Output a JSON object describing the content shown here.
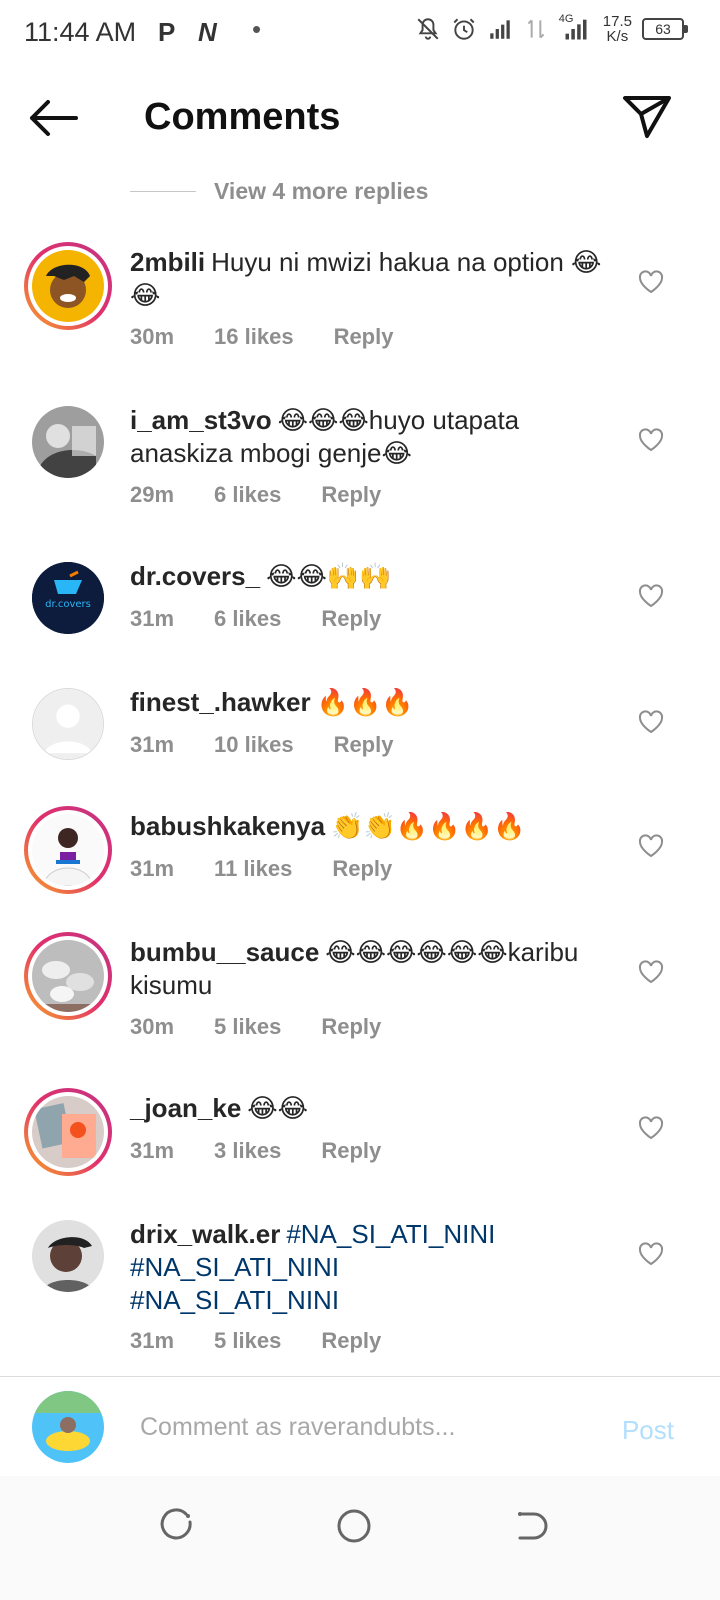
{
  "status_bar": {
    "time": "11:44 AM",
    "app_icons": [
      "P",
      "N"
    ],
    "net_speed_value": "17.5",
    "net_speed_unit": "K/s",
    "network_label": "4G",
    "battery": "63"
  },
  "header": {
    "title": "Comments"
  },
  "view_more_replies": "View 4 more replies",
  "comments": [
    {
      "username": "2mbili",
      "text": "Huyu ni mwizi hakua na option 😂😂",
      "time": "30m",
      "likes": "16 likes",
      "reply": "Reply"
    },
    {
      "username": "i_am_st3vo",
      "text": "😂😂😂huyo utapata anaskiza mbogi genje😂",
      "time": "29m",
      "likes": "6 likes",
      "reply": "Reply"
    },
    {
      "username": "dr.covers_",
      "text": "😂😂🙌🙌",
      "time": "31m",
      "likes": "6 likes",
      "reply": "Reply",
      "avatar_text": "dr.covers"
    },
    {
      "username": "finest_.hawker",
      "text": "🔥🔥🔥",
      "time": "31m",
      "likes": "10 likes",
      "reply": "Reply"
    },
    {
      "username": "babushkakenya",
      "text": "👏👏🔥🔥🔥🔥",
      "time": "31m",
      "likes": "11 likes",
      "reply": "Reply"
    },
    {
      "username": "bumbu__sauce",
      "text": "😂😂😂😂😂😂karibu kisumu",
      "time": "30m",
      "likes": "5 likes",
      "reply": "Reply"
    },
    {
      "username": "_joan_ke",
      "text": "😂😂",
      "time": "31m",
      "likes": "3 likes",
      "reply": "Reply"
    },
    {
      "username": "drix_walk.er",
      "hashtags": [
        "#NA_SI_ATI_NINI",
        "#NA_SI_ATI_NINI",
        "#NA_SI_ATI_NINI"
      ],
      "time": "31m",
      "likes": "5 likes",
      "reply": "Reply"
    }
  ],
  "input": {
    "placeholder": "Comment as raverandubts...",
    "post_label": "Post"
  },
  "colors": {
    "text": "#262626",
    "meta": "#8e8e8e",
    "hashtag": "#00376b",
    "post_disabled": "#b2dffc",
    "story_ring_start": "#f9a825",
    "story_ring_end": "#c13584"
  },
  "icons": {
    "back": "arrow-left-icon",
    "send": "paper-plane-icon",
    "like": "heart-outline-icon",
    "nav_recent": "recents-icon",
    "nav_home": "home-circle-icon",
    "nav_back": "back-nav-icon"
  }
}
